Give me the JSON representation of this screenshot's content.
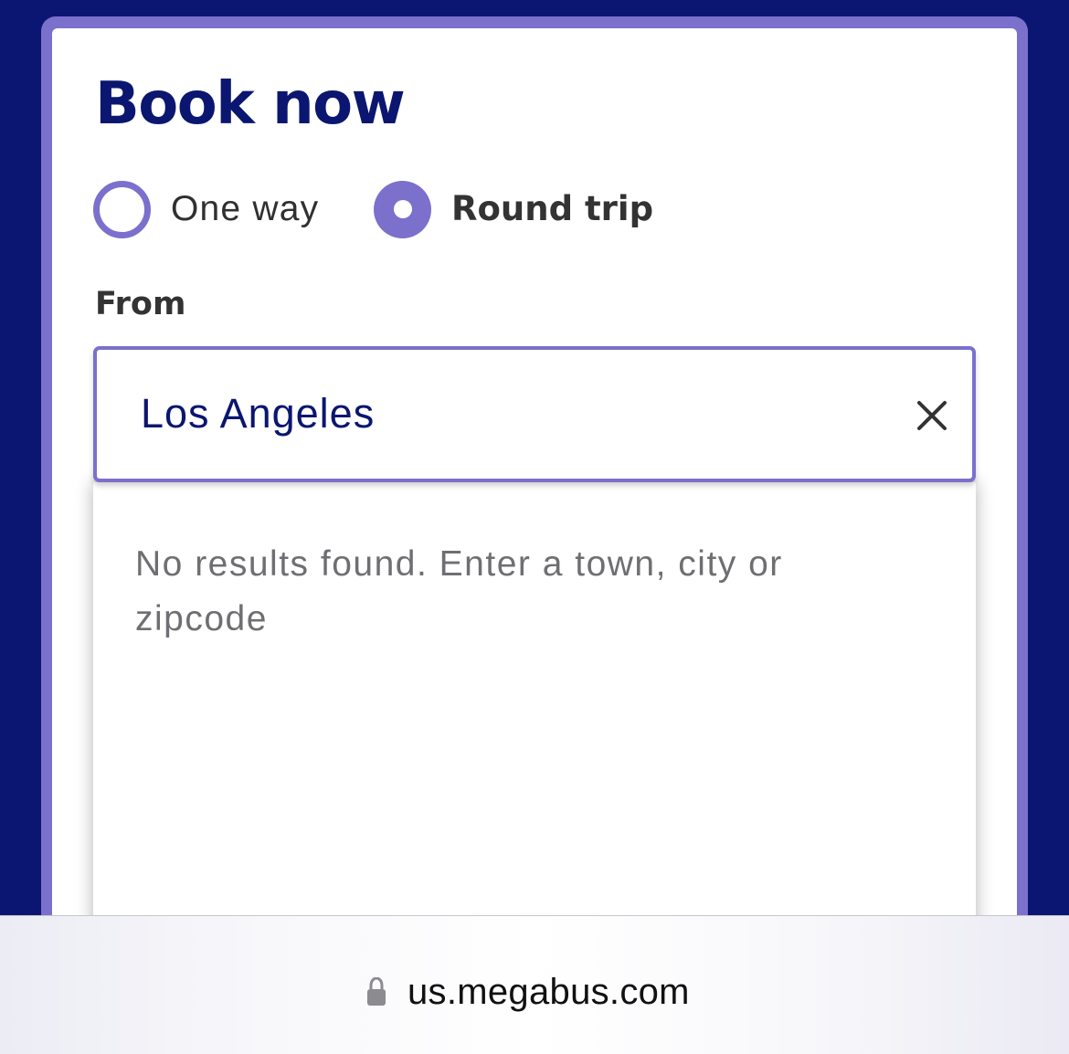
{
  "booking": {
    "title": "Book now",
    "trip_type": {
      "options": [
        {
          "label": "One way",
          "selected": false
        },
        {
          "label": "Round trip",
          "selected": true
        }
      ]
    },
    "from": {
      "label": "From",
      "value": "Los Angeles",
      "clear_icon": "close-icon",
      "dropdown_message": "No results found. Enter a town, city or zipcode"
    }
  },
  "browser": {
    "url": "us.megabus.com",
    "lock_icon": "lock-icon"
  },
  "colors": {
    "page_background": "#0b1673",
    "accent": "#7b70cc",
    "title": "#0a1670",
    "text": "#333333",
    "muted_text": "#6f6f73"
  }
}
